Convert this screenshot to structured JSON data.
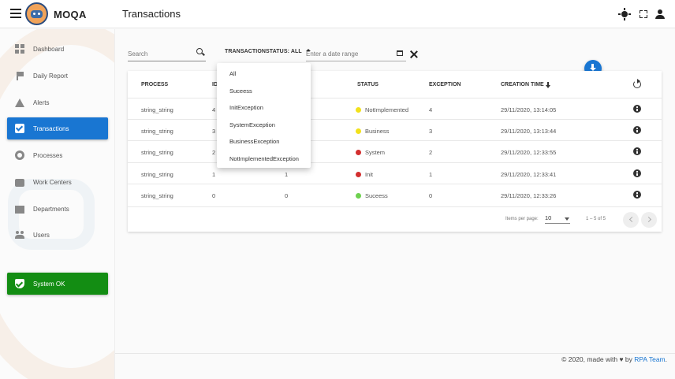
{
  "app": {
    "brand": "MOQA",
    "title": "Transactions"
  },
  "sidebar": {
    "items": [
      {
        "label": "Dashboard",
        "icon": "dashboard-icon"
      },
      {
        "label": "Daily Report",
        "icon": "flag-icon"
      },
      {
        "label": "Alerts",
        "icon": "warning-icon"
      },
      {
        "label": "Transactions",
        "icon": "check-box-icon",
        "active": true
      },
      {
        "label": "Processes",
        "icon": "gear-icon"
      },
      {
        "label": "Work Centers",
        "icon": "briefcase-icon"
      },
      {
        "label": "Departments",
        "icon": "store-icon"
      },
      {
        "label": "Users",
        "icon": "people-icon"
      }
    ],
    "system_status": {
      "label": "System OK",
      "icon": "shield-check-icon",
      "color": "#138d13"
    }
  },
  "filters": {
    "search_placeholder": "Search",
    "status_label": "TRANSACTIONSTATUS: ALL",
    "date_placeholder": "Enter a date range"
  },
  "status_dropdown": {
    "options": [
      "All",
      "Suceess",
      "InitException",
      "SystemException",
      "BusinessException",
      "NotImplementedException"
    ]
  },
  "table": {
    "headers": {
      "process": "PROCESS",
      "id": "ID",
      "status": "STATUS",
      "exception": "EXCEPTION",
      "creation_time": "CREATION TIME"
    },
    "rows": [
      {
        "process": "string_string",
        "id": "4",
        "c3": "",
        "status": "NotImplemented",
        "status_color": "#f2e11c",
        "exception": "4",
        "time": "29/11/2020, 13:14:05"
      },
      {
        "process": "string_string",
        "id": "3",
        "c3": "",
        "status": "Business",
        "status_color": "#f2e11c",
        "exception": "3",
        "time": "29/11/2020, 13:13:44"
      },
      {
        "process": "string_string",
        "id": "2",
        "c3": "",
        "status": "System",
        "status_color": "#d32f2f",
        "exception": "2",
        "time": "29/11/2020, 12:33:55"
      },
      {
        "process": "string_string",
        "id": "1",
        "c3": "1",
        "status": "Init",
        "status_color": "#d32f2f",
        "exception": "1",
        "time": "29/11/2020, 12:33:41"
      },
      {
        "process": "string_string",
        "id": "0",
        "c3": "0",
        "status": "Suceess",
        "status_color": "#6ed14f",
        "exception": "0",
        "time": "29/11/2020, 12:33:26"
      }
    ]
  },
  "paginator": {
    "items_per_page_label": "Items per page:",
    "items_per_page": "10",
    "range": "1 – 5 of 5"
  },
  "footer": {
    "text": "© 2020, made with ♥ by",
    "link": "RPA Team",
    "end": "."
  }
}
